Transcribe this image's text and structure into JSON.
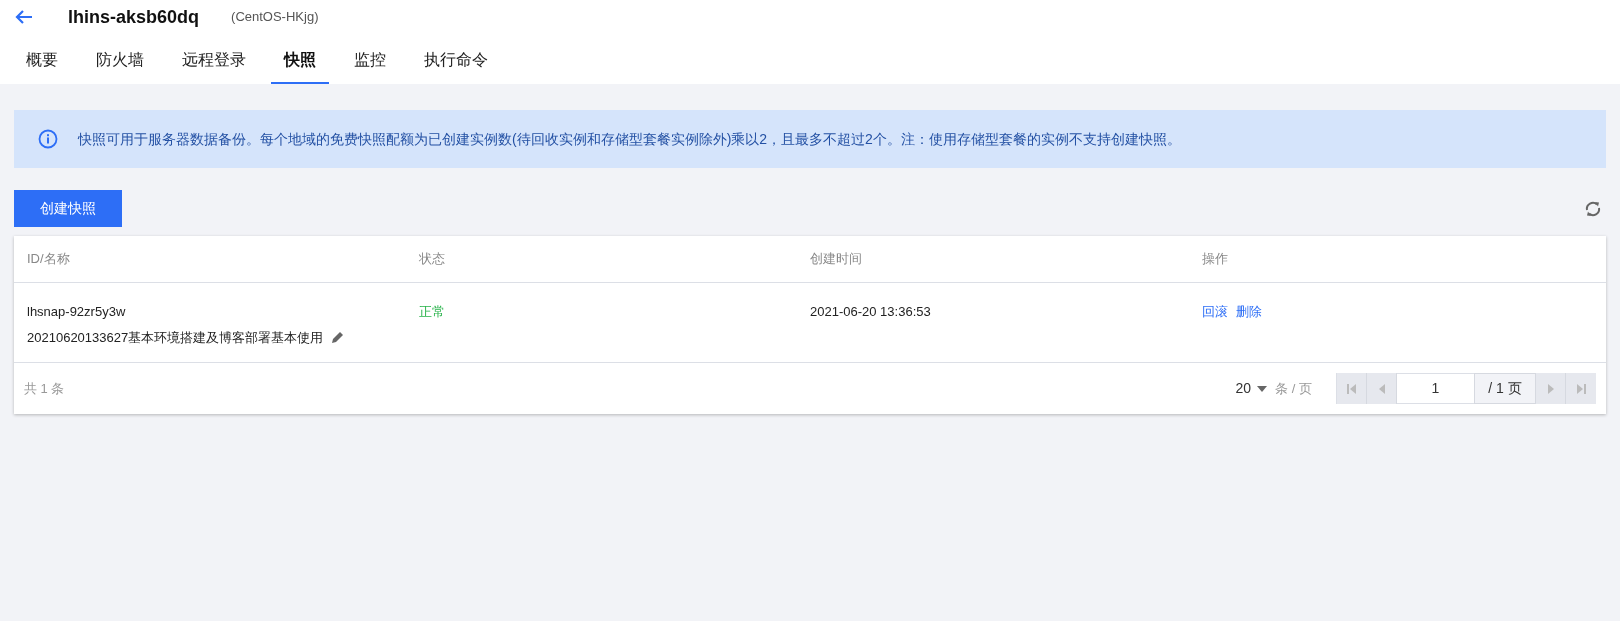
{
  "header": {
    "title": "lhins-aksb60dq",
    "subtitle": "(CentOS-HKjg)"
  },
  "tabs": [
    {
      "label": "概要",
      "selected": false
    },
    {
      "label": "防火墙",
      "selected": false
    },
    {
      "label": "远程登录",
      "selected": false
    },
    {
      "label": "快照",
      "selected": true
    },
    {
      "label": "监控",
      "selected": false
    },
    {
      "label": "执行命令",
      "selected": false
    }
  ],
  "notice": "快照可用于服务器数据备份。每个地域的免费快照配额为已创建实例数(待回收实例和存储型套餐实例除外)乘以2，且最多不超过2个。注：使用存储型套餐的实例不支持创建快照。",
  "create_button": "创建快照",
  "table": {
    "columns": [
      "ID/名称",
      "状态",
      "创建时间",
      "操作"
    ],
    "rows": [
      {
        "id": "lhsnap-92zr5y3w",
        "name": "20210620133627基本环境搭建及博客部署基本使用",
        "status": "正常",
        "created": "2021-06-20 13:36:53",
        "actions": [
          "回滚",
          "删除"
        ]
      }
    ]
  },
  "footer": {
    "total": "共 1 条",
    "page_size": "20",
    "page_size_unit": "条 / 页",
    "page_input": "1",
    "page_total": "/ 1 页"
  }
}
